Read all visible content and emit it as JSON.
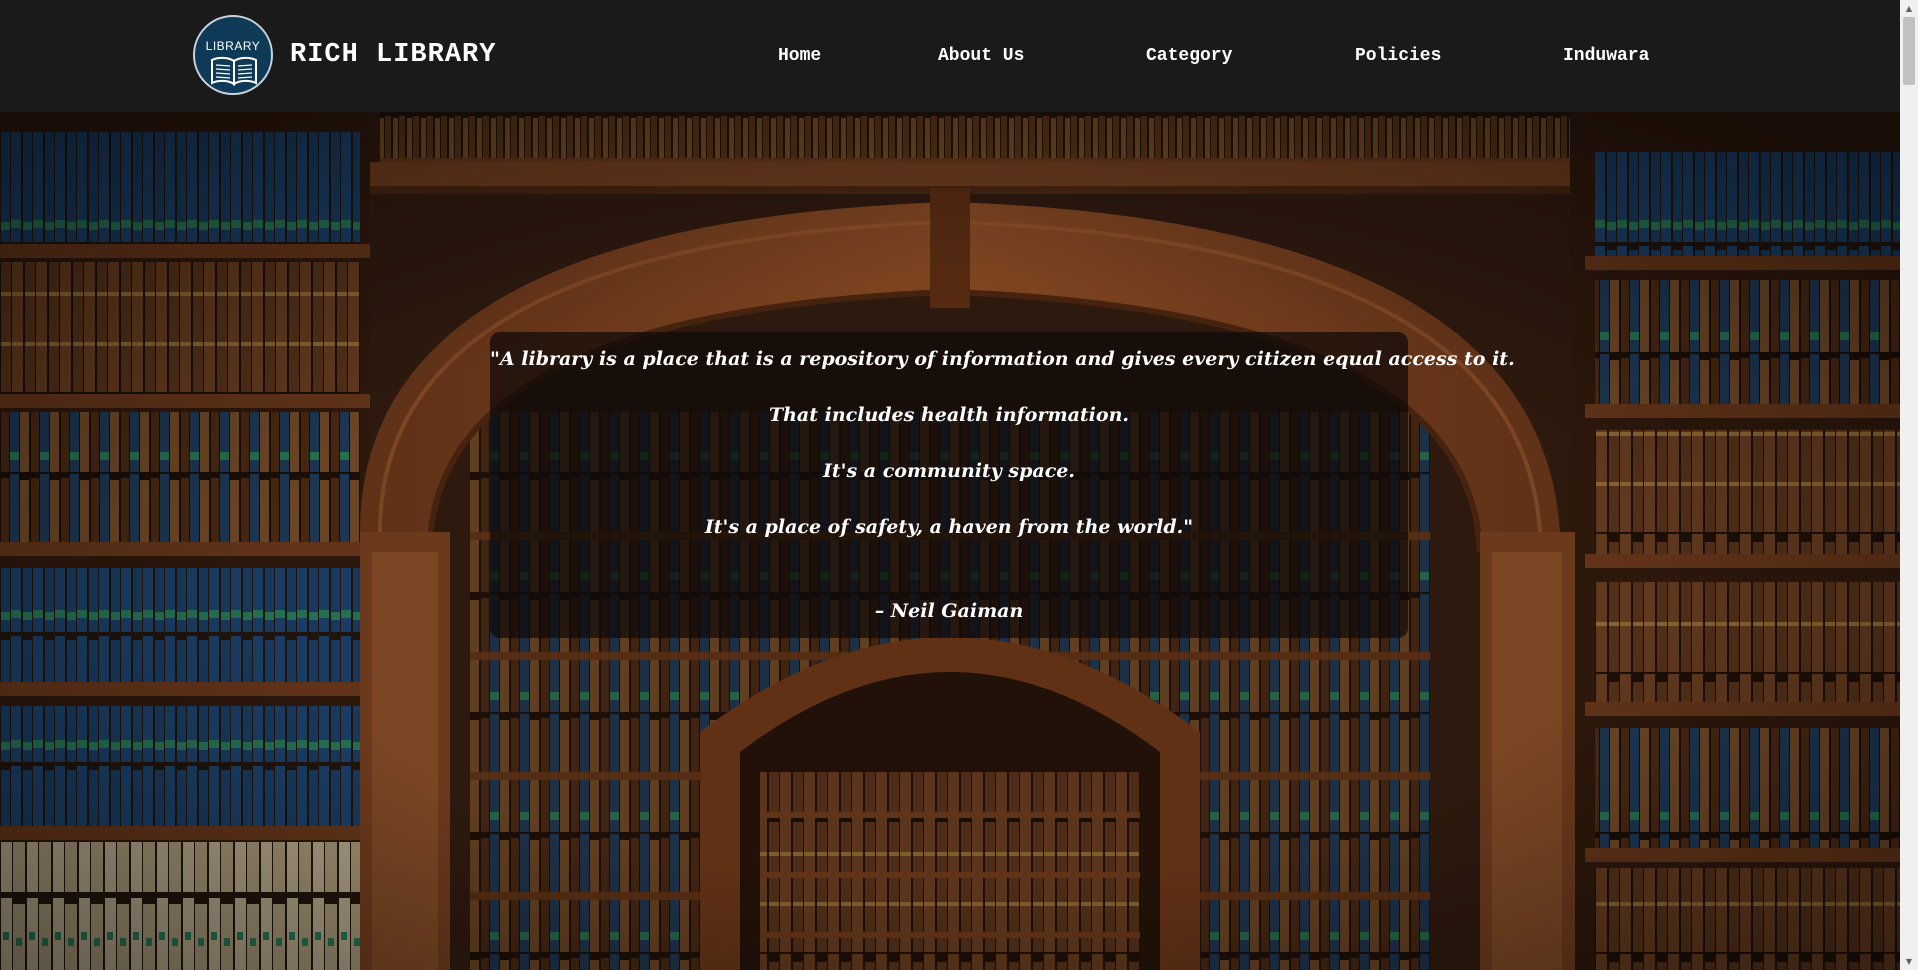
{
  "header": {
    "logo_text": "LIBRARY",
    "brand": "RICH LIBRARY",
    "nav": [
      {
        "label": "Home"
      },
      {
        "label": "About Us"
      },
      {
        "label": "Category"
      },
      {
        "label": "Policies"
      },
      {
        "label": "Induwara"
      }
    ]
  },
  "quote": {
    "lines": [
      "\"A library is a place that is a repository of information and gives every citizen equal access to it.",
      "That includes health information.",
      "It's a community space.",
      "It's a place of safety, a haven from the world.\""
    ],
    "author": "– Neil Gaiman"
  },
  "colors": {
    "navbar_bg": "#1a1a1a",
    "logo_bg": "#0e3a57",
    "text": "#ffffff",
    "wood": "#8a4a25"
  },
  "icons": {
    "logo": "open-book-icon"
  }
}
